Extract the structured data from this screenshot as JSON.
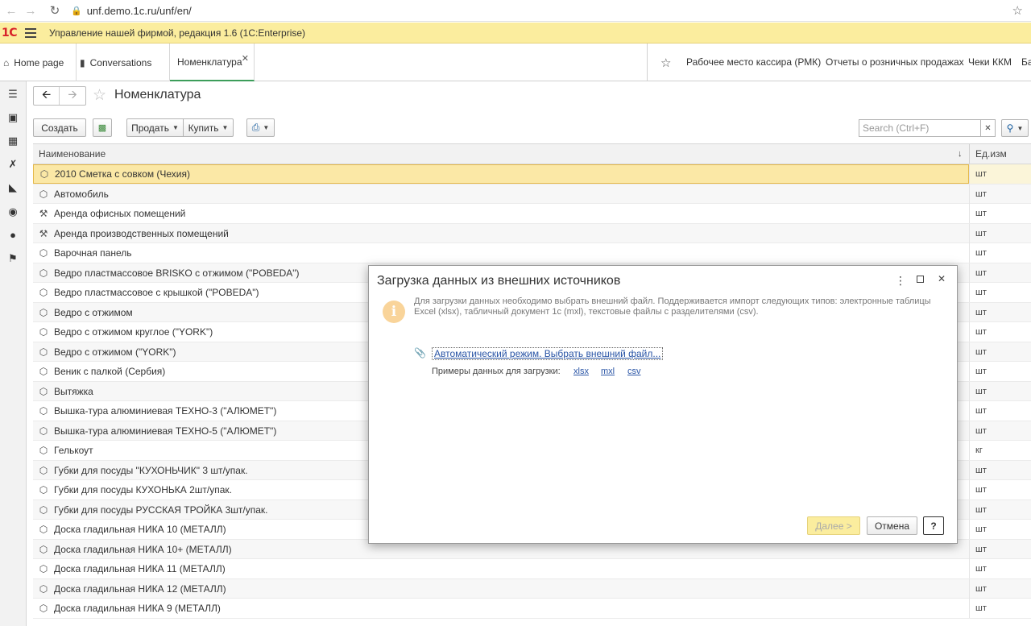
{
  "browser": {
    "url": "unf.demo.1c.ru/unf/en/"
  },
  "app": {
    "logo": "1С",
    "title": "Управление нашей фирмой, редакция 1.6   (1С:Enterprise)"
  },
  "tabs": [
    {
      "label": "Home page"
    },
    {
      "label": "Conversations"
    },
    {
      "label": "Номенклатура"
    }
  ],
  "favorites": [
    {
      "label": "Рабочее место кассира (РМК)"
    },
    {
      "label": "Отчеты о розничных продажах"
    },
    {
      "label": "Чеки ККМ"
    },
    {
      "label": "Ба"
    }
  ],
  "page": {
    "title": "Номенклатура"
  },
  "toolbar": {
    "create_label": "Создать",
    "sell_label": "Продать",
    "buy_label": "Купить",
    "search_placeholder": "Search (Ctrl+F)"
  },
  "table": {
    "col_name": "Наименование",
    "col_unit": "Ед.изм",
    "rows": [
      {
        "icon": "box-icon",
        "name": "2010 Сметка с совком (Чехия)",
        "unit": "шт",
        "selected": true
      },
      {
        "icon": "box-icon",
        "name": "Автомобиль",
        "unit": "шт"
      },
      {
        "icon": "tools-icon",
        "name": "Аренда офисных помещений",
        "unit": "шт"
      },
      {
        "icon": "tools-icon",
        "name": "Аренда производственных помещений",
        "unit": "шт"
      },
      {
        "icon": "box-icon",
        "name": "Варочная панель",
        "unit": "шт"
      },
      {
        "icon": "box-icon",
        "name": "Ведро пластмассовое BRISKO с отжимом (\"POBEDA\")",
        "unit": "шт"
      },
      {
        "icon": "box-icon",
        "name": "Ведро пластмассовое с крышкой (\"POBEDA\")",
        "unit": "шт"
      },
      {
        "icon": "box-icon",
        "name": "Ведро с отжимом",
        "unit": "шт"
      },
      {
        "icon": "box-icon",
        "name": "Ведро с отжимом  круглое (\"YORK\")",
        "unit": "шт"
      },
      {
        "icon": "box-icon",
        "name": "Ведро с отжимом (\"YORK\")",
        "unit": "шт"
      },
      {
        "icon": "box-icon",
        "name": "Веник с палкой (Сербия)",
        "unit": "шт"
      },
      {
        "icon": "box-icon",
        "name": "Вытяжка",
        "unit": "шт"
      },
      {
        "icon": "box-icon",
        "name": "Вышка-тура алюминиевая ТЕХНО-3 (\"АЛЮМЕТ\")",
        "unit": "шт"
      },
      {
        "icon": "box-icon",
        "name": "Вышка-тура алюминиевая ТЕХНО-5 (\"АЛЮМЕТ\")",
        "unit": "шт"
      },
      {
        "icon": "box-icon",
        "name": "Гелькоут",
        "unit": "кг"
      },
      {
        "icon": "box-icon",
        "name": "Губки для посуды \"КУХОНЬЧИК\" 3 шт/упак.",
        "unit": "шт"
      },
      {
        "icon": "box-icon",
        "name": "Губки для посуды КУХОНЬКА 2шт/упак.",
        "unit": "шт"
      },
      {
        "icon": "box-icon",
        "name": "Губки для посуды РУССКАЯ ТРОЙКА 3шт/упак.",
        "unit": "шт"
      },
      {
        "icon": "box-icon",
        "name": "Доска гладильная  НИКА 10 (МЕТАЛЛ)",
        "unit": "шт"
      },
      {
        "icon": "box-icon",
        "name": "Доска гладильная  НИКА 10+ (МЕТАЛЛ)",
        "unit": "шт"
      },
      {
        "icon": "box-icon",
        "name": "Доска гладильная  НИКА 11 (МЕТАЛЛ)",
        "unit": "шт"
      },
      {
        "icon": "box-icon",
        "name": "Доска гладильная  НИКА 12 (МЕТАЛЛ)",
        "unit": "шт"
      },
      {
        "icon": "box-icon",
        "name": "Доска гладильная  НИКА 9 (МЕТАЛЛ)",
        "unit": "шт"
      }
    ]
  },
  "modal": {
    "title": "Загрузка данных из внешних источников",
    "info": "Для загрузки данных необходимо выбрать внешний файл. Поддерживается импорт следующих типов: электронные таблицы Excel (xlsx), табличный документ 1с (mxl), текстовые файлы с разделителями (csv).",
    "auto_link": "Автоматический режим. Выбрать внешний файл...",
    "examples_label": "Примеры данных для загрузки:",
    "examples": [
      "xlsx",
      "mxl",
      "csv"
    ],
    "next_label": "Далее >",
    "cancel_label": "Отмена",
    "help_label": "?"
  },
  "colors": {
    "header_bg": "#fbed9e",
    "selected_row": "#fbe8a6",
    "link": "#2a55a6",
    "active_tab": "#3c9d5a"
  }
}
